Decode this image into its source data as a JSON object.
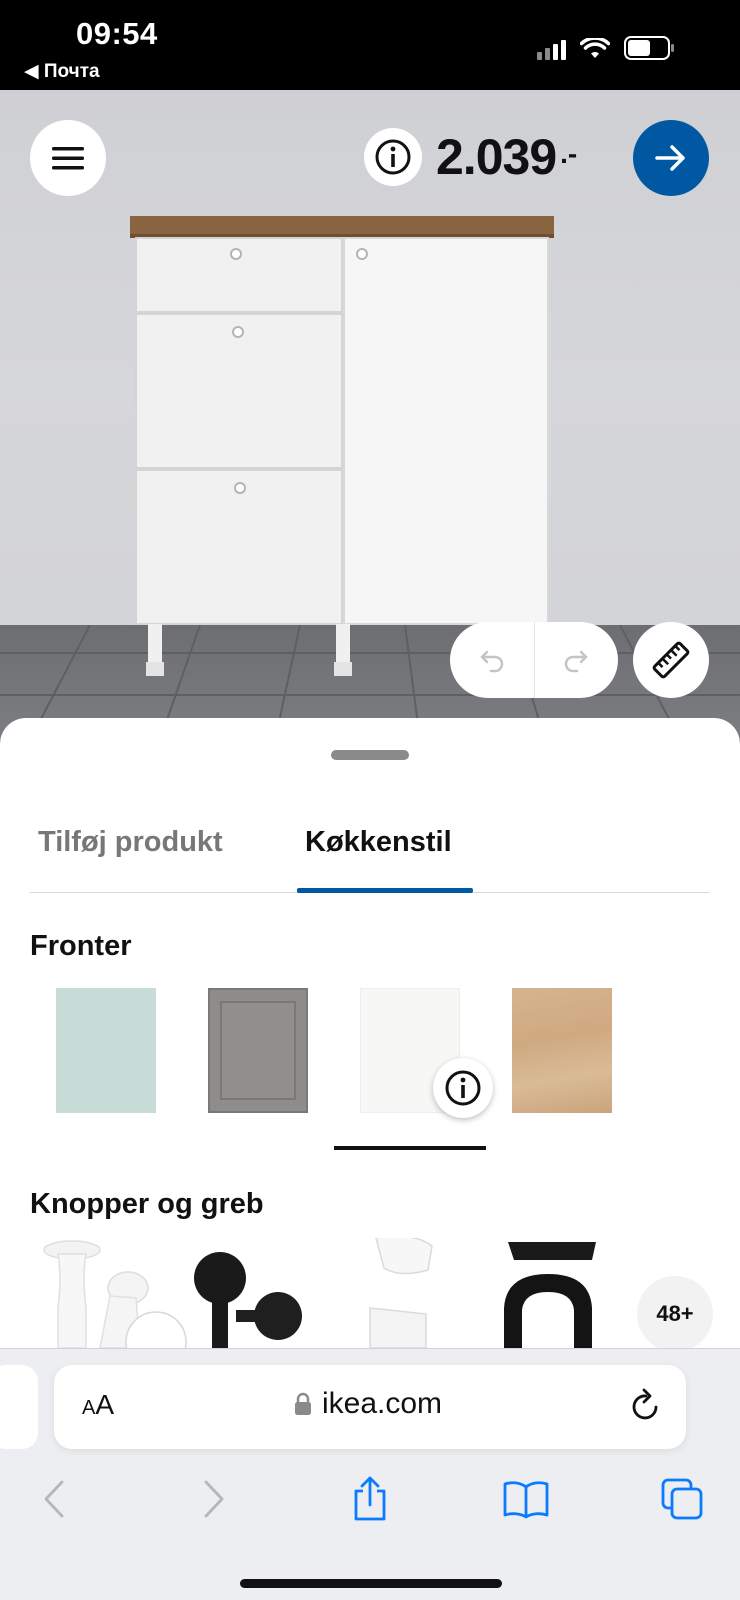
{
  "status_bar": {
    "time": "09:54",
    "back_label": "◀ Почта"
  },
  "planner": {
    "price": "2.039",
    "price_suffix": ".-",
    "icons": {
      "menu": "hamburger-menu-icon",
      "info": "info-icon",
      "next": "arrow-right-icon",
      "undo": "undo-icon",
      "redo": "redo-icon",
      "measure": "ruler-icon"
    },
    "colors": {
      "accent": "#0058a3"
    }
  },
  "sheet": {
    "tabs": [
      {
        "label": "Tilføj produkt",
        "selected": false
      },
      {
        "label": "Køkkenstil",
        "selected": true
      }
    ],
    "fronts": {
      "title": "Fronter",
      "swatches": [
        {
          "name": "light-green-front",
          "color": "#c8dcd8"
        },
        {
          "name": "grey-framed-front",
          "color": "#8f8d8b"
        },
        {
          "name": "white-front",
          "color": "#f7f7f5",
          "selected": true
        },
        {
          "name": "oak-front",
          "color": "#d2ae86"
        }
      ]
    },
    "handles": {
      "title": "Knopper og greb",
      "more_count": "48+"
    }
  },
  "safari": {
    "text_size_label_small": "A",
    "text_size_label_large": "A",
    "url": "ikea.com"
  }
}
